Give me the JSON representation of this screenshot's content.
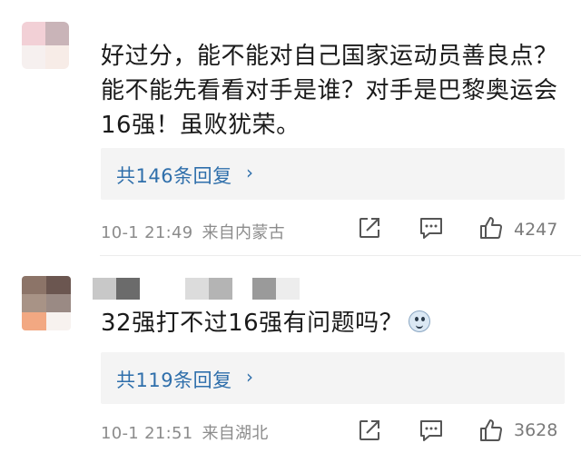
{
  "comments": [
    {
      "text_lines": [
        "好过分，能不能对自己国家运动员善良点？",
        "能不能先看看对手是谁？对手是巴黎奥运会",
        "16强！虽败犹荣。"
      ],
      "replies_label": "共146条回复",
      "replies_chevron": "›",
      "date_time": "10-1 21:49",
      "location": "来自内蒙古",
      "likes": "4247",
      "icons": [
        "share-icon",
        "comment-icon",
        "like-icon"
      ],
      "avatar_colors": [
        "#f2d0d6",
        "#c9b4b8",
        "#f6f0ef",
        "#f7ece7",
        "#f1e8e7",
        "#ffffff"
      ]
    },
    {
      "text": "32强打不过16强有问题吗？",
      "emoji": "doge-emoji",
      "replies_label": "共119条回复",
      "replies_chevron": "›",
      "date_time": "10-1 21:51",
      "location": "来自湖北",
      "likes": "3628",
      "icons": [
        "share-icon",
        "comment-icon",
        "like-icon"
      ],
      "avatar_colors": [
        "#8c7468",
        "#6b5650",
        "#a89386",
        "#9a8a84",
        "#d6b8a8",
        "#f2a882",
        "#f7f2ef",
        "#efe7e3"
      ],
      "name_mosaic_colors": [
        "#c8c8c8",
        "#6b6b6b",
        "#ffffff",
        "#dcdcdc",
        "#b4b4b4",
        "#ffffff",
        "#9a9a9a",
        "#ededed"
      ]
    }
  ],
  "colors": {
    "reply_link": "#2f6fab",
    "meta_text": "#8c8c8c",
    "reply_bg": "#f4f4f4"
  }
}
